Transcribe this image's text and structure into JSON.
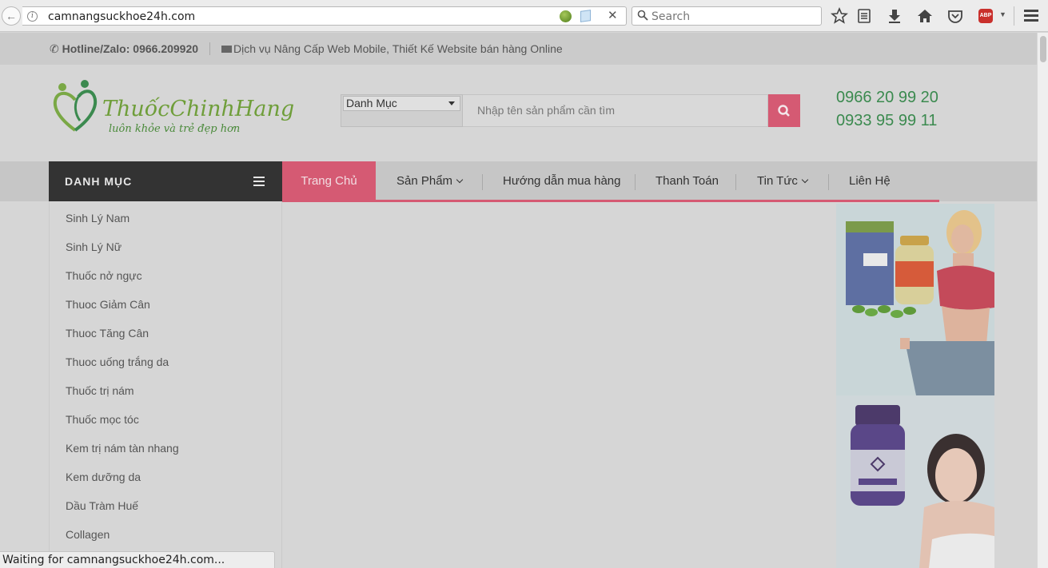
{
  "browser": {
    "url": "camnangsuckhoe24h.com",
    "search_placeholder": "Search",
    "status_text": "Waiting for camnangsuckhoe24h.com...",
    "abp_label": "ABP"
  },
  "topbar": {
    "hotline": "Hotline/Zalo: 0966.209920",
    "service": "Dịch vụ Nâng Cấp Web Mobile, Thiết Kế Website bán hàng Online"
  },
  "header": {
    "logo_text": "ThuốcChinhHang",
    "logo_tagline": "luôn khỏe và trẻ đẹp hơn",
    "category_select": "Danh Mục",
    "search_placeholder": "Nhập tên sản phẩm cần tìm",
    "phone_1": "0966 20 99 20",
    "phone_2": "0933 95 99 11"
  },
  "nav": {
    "danh_muc": "DANH MỤC",
    "items": [
      {
        "label": "Trang Chủ",
        "active": true
      },
      {
        "label": "Sản Phẩm",
        "dropdown": true
      },
      {
        "label": "Hướng dẫn mua hàng"
      },
      {
        "label": "Thanh Toán"
      },
      {
        "label": "Tin Tức",
        "dropdown": true
      },
      {
        "label": "Liên Hệ"
      }
    ]
  },
  "sidebar": {
    "items": [
      "Sinh Lý Nam",
      "Sinh Lý Nữ",
      "Thuốc nở ngực",
      "Thuoc Giảm Cân",
      "Thuoc Tăng Cân",
      "Thuoc uống trắng da",
      "Thuốc trị nám",
      "Thuốc mọc tóc",
      "Kem trị nám tàn nhang",
      "Kem dưỡng da",
      "Dầu Tràm Huế",
      "Collagen"
    ]
  },
  "colors": {
    "accent_pink": "#d55a73",
    "brand_green": "#3b8a4f",
    "dark_menu": "#333333"
  }
}
